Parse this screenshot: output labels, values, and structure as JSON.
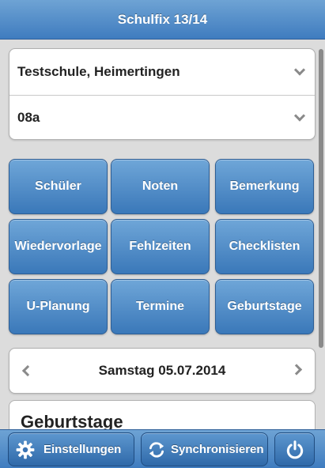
{
  "header": {
    "title": "Schulfix 13/14"
  },
  "selects": {
    "school": {
      "value": "Testschule, Heimertingen",
      "icon": "chevron-down-icon"
    },
    "class": {
      "value": "08a",
      "icon": "chevron-down-icon"
    }
  },
  "menu": {
    "buttons": [
      {
        "label": "Schüler"
      },
      {
        "label": "Noten"
      },
      {
        "label": "Bemerkung"
      },
      {
        "label": "Wiedervorlage"
      },
      {
        "label": "Fehlzeiten"
      },
      {
        "label": "Checklisten"
      },
      {
        "label": "U-Planung"
      },
      {
        "label": "Termine"
      },
      {
        "label": "Geburtstage"
      }
    ]
  },
  "date_nav": {
    "date": "Samstag 05.07.2014",
    "prev_icon": "chevron-left-icon",
    "next_icon": "chevron-right-icon"
  },
  "birthday_section": {
    "title": "Geburtstage"
  },
  "footer": {
    "settings_label": "Einstellungen",
    "sync_label": "Synchronisieren",
    "settings_icon": "gear-icon",
    "sync_icon": "sync-icon",
    "power_icon": "power-icon"
  },
  "colors": {
    "accent": "#3f7cbf",
    "button_top": "#6fa6d8",
    "button_bottom": "#3a78b9",
    "background": "#dcdcdc"
  }
}
